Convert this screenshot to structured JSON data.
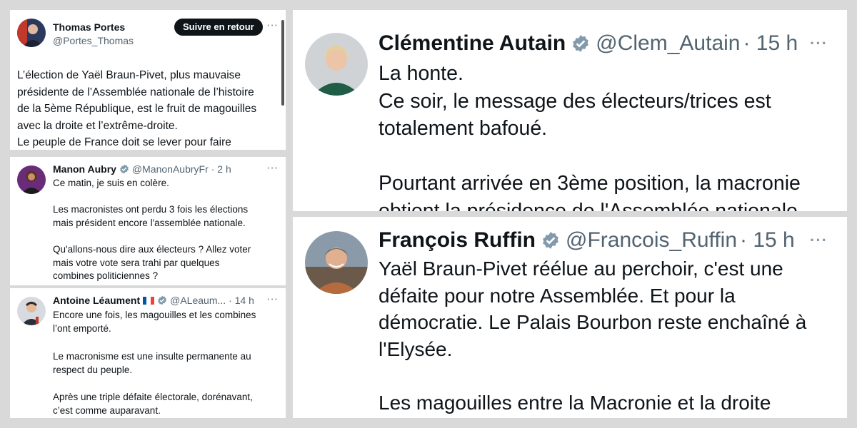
{
  "tweets": {
    "portes": {
      "name": "Thomas Portes",
      "handle": "@Portes_Thomas",
      "follow_label": "Suivre en retour",
      "more": "···",
      "text": "L’élection de Yaël Braun-Pivet, plus mauvaise\nprésidente de l’Assemblée nationale de l’histoire\nde la 5ème République, est le fruit de magouilles\navec la droite et l’extrême-droite.\nLe peuple de France doit se lever pour faire"
    },
    "aubry": {
      "name": "Manon Aubry",
      "handle": "@ManonAubryFr",
      "time": "· 2 h",
      "more": "···",
      "text": "Ce matin, je suis en colère.\n\nLes macronistes ont perdu 3 fois les élections\nmais président encore l'assemblée nationale.\n\nQu'allons-nous dire aux électeurs ? Allez voter\nmais votre vote sera trahi par quelques\ncombines politiciennes ?"
    },
    "leaument": {
      "name": "Antoine Léaument",
      "flag": "🇫🇷",
      "handle": "@ALeaum...",
      "time": "· 14 h",
      "more": "···",
      "text": "Encore une fois, les magouilles et les combines\nl’ont emporté.\n\nLe macronisme est une insulte permanente au\nrespect du peuple.\n\nAprès une triple défaite électorale, dorénavant,\nc’est comme auparavant."
    },
    "autain": {
      "name": "Clémentine Autain",
      "handle": "@Clem_Autain",
      "time": "· 15 h",
      "more": "···",
      "text": "La honte.\nCe soir, le message des électeurs/trices est\ntotalement bafoué.\n\nPourtant arrivée en 3ème position, la macronie\nobtient la présidence de l'Assemblée nationale"
    },
    "ruffin": {
      "name": "François Ruffin",
      "handle": "@Francois_Ruffin",
      "time": "· 15 h",
      "more": "···",
      "text": "Yaël Braun-Pivet réélue au perchoir, c'est une\ndéfaite pour notre Assemblée. Et pour la\ndémocratie. Le Palais Bourbon reste enchaîné à\nl'Elysée.\n\nLes magouilles entre la Macronie et la droite"
    }
  },
  "colors": {
    "verified": "#829aab",
    "handle": "#536471",
    "background": "#d9d9d9"
  }
}
